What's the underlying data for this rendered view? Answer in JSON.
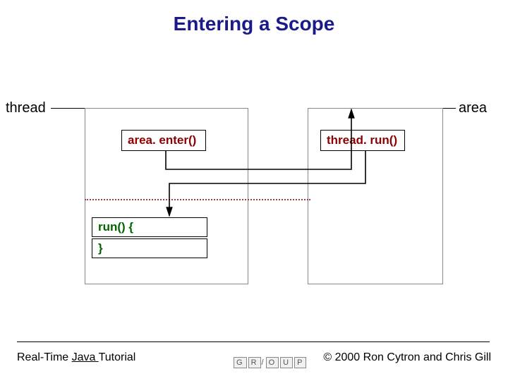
{
  "title": "Entering a Scope",
  "labels": {
    "thread": "thread",
    "area": "area"
  },
  "calls": {
    "area_enter": "area. enter()",
    "thread_run": "thread. run()",
    "run_open": "run() {",
    "run_close": "}"
  },
  "footer": {
    "tutorial_prefix": "Real-Time ",
    "tutorial_underlined": "Java ",
    "tutorial_suffix": "Tutorial",
    "copyright": "© 2000 Ron Cytron and Chris Gill",
    "logo_letters": [
      "G",
      "R",
      "O",
      "U",
      "P"
    ]
  }
}
